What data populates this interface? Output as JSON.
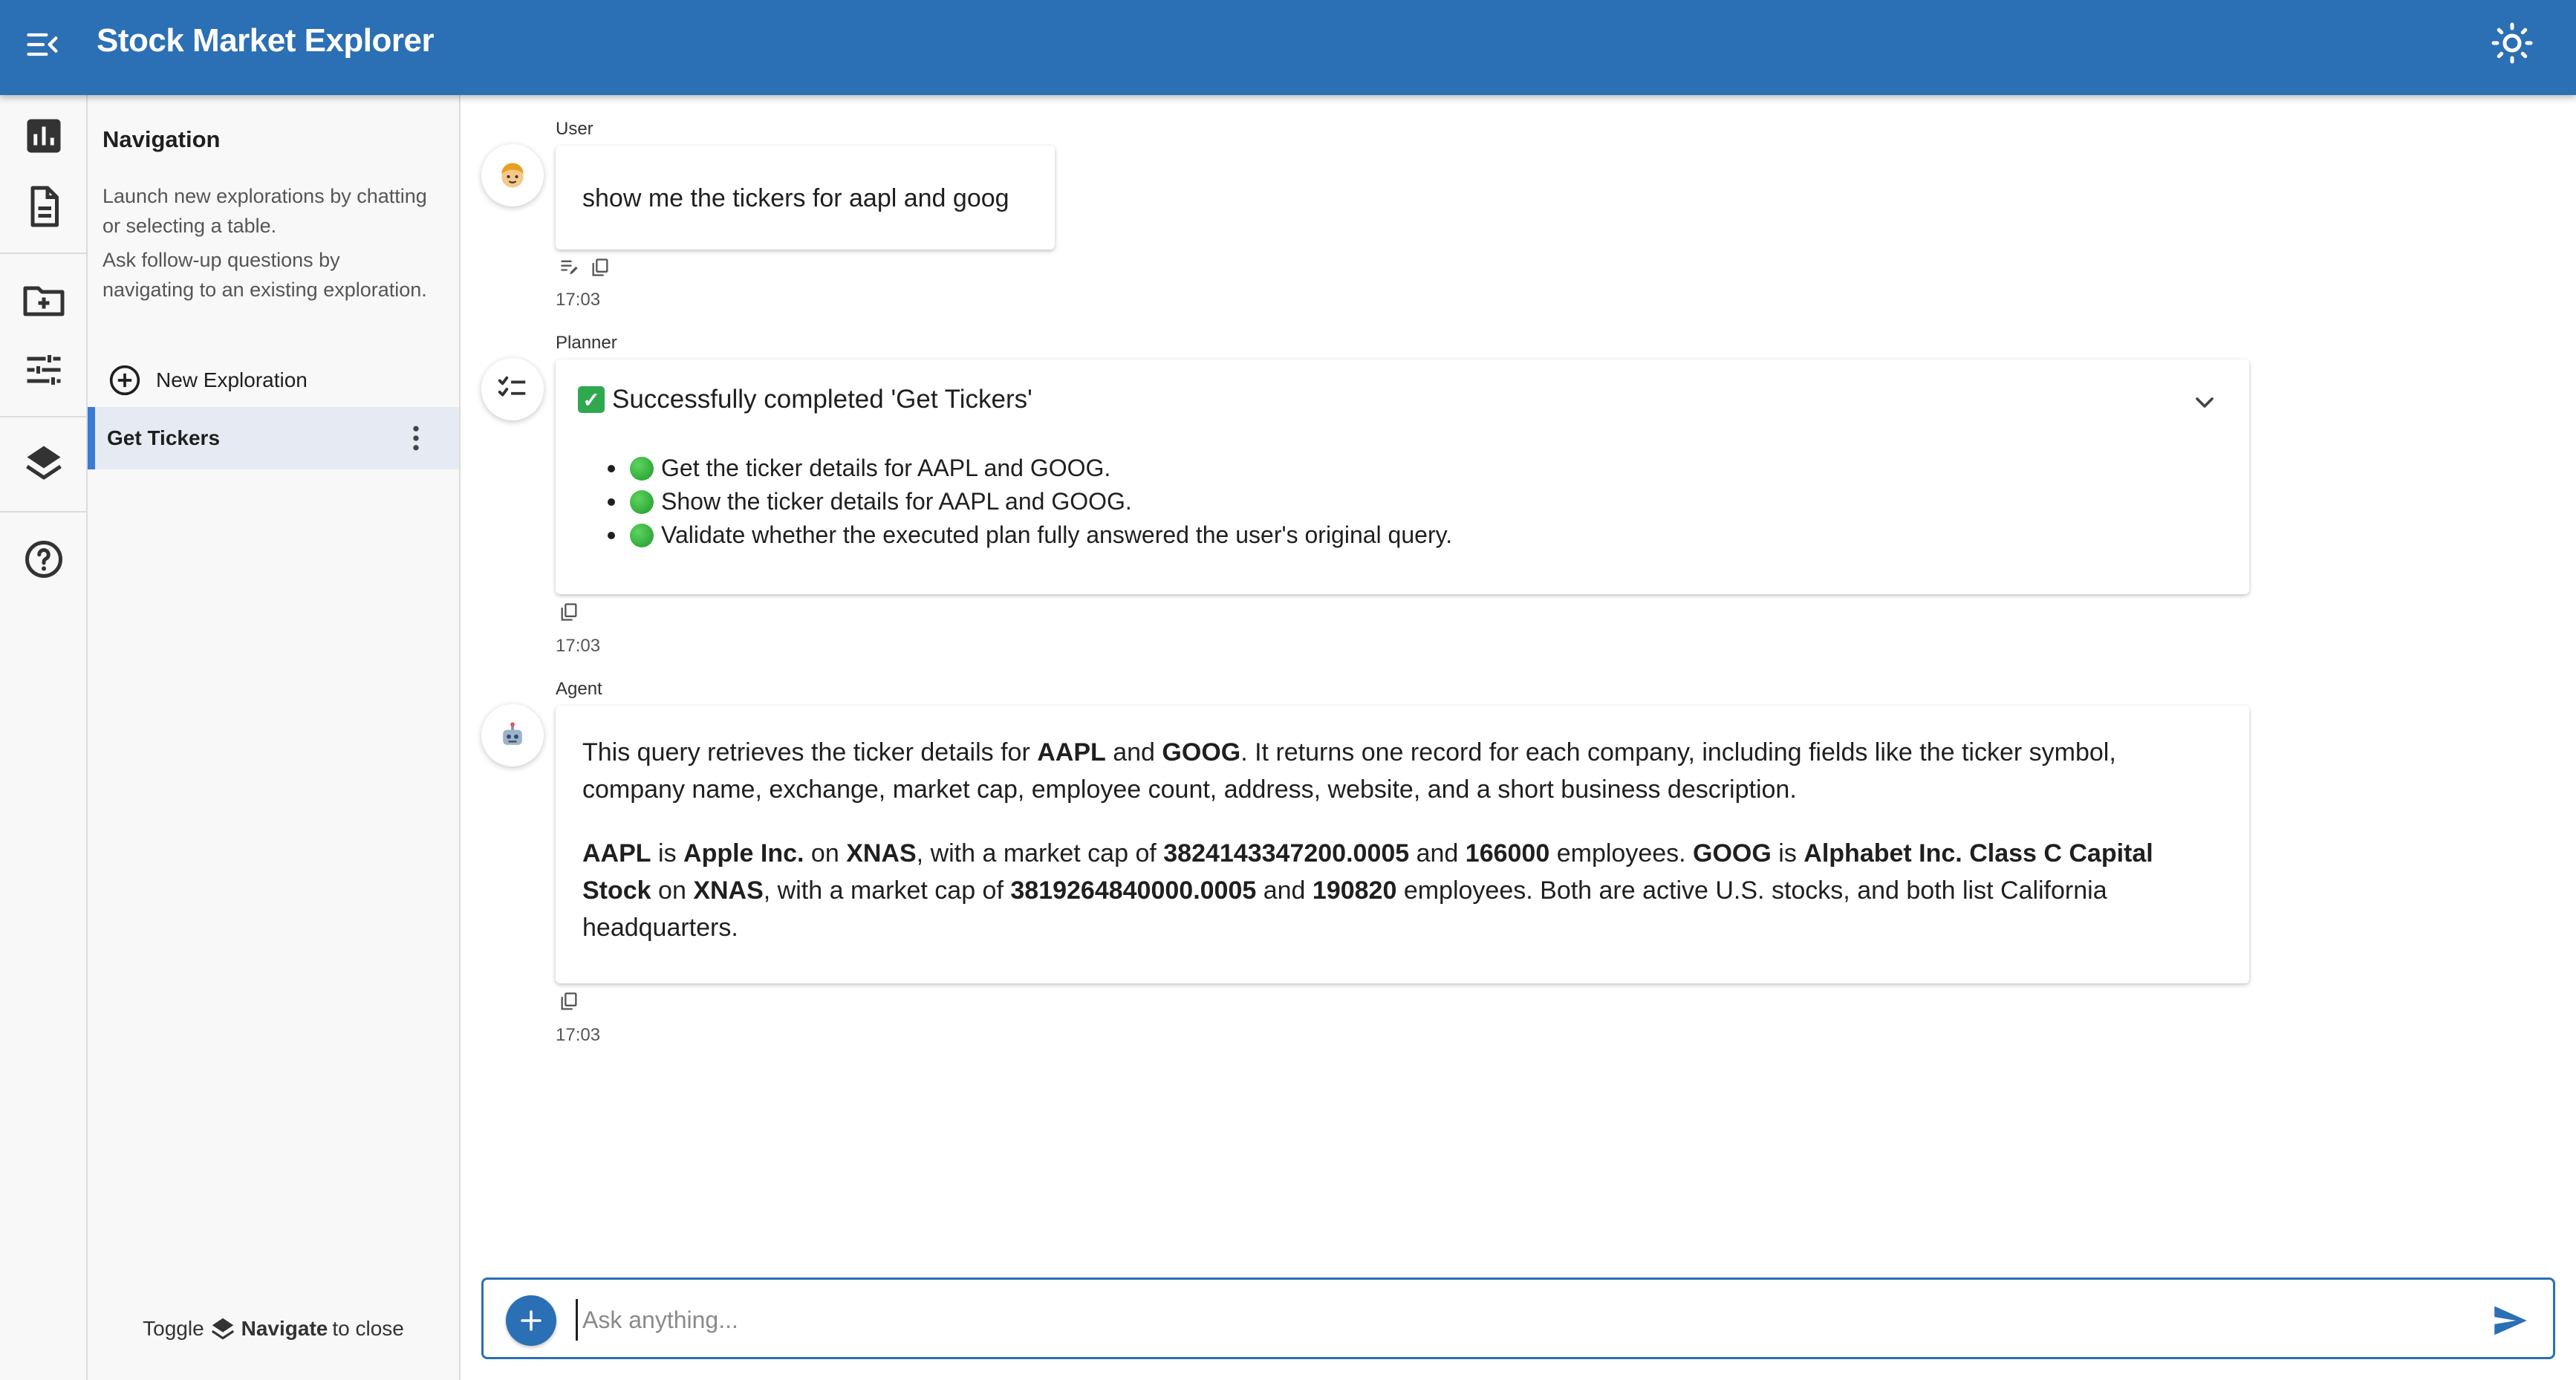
{
  "header": {
    "title": "Stock Market Explorer",
    "menu_icon": "menu-collapse-icon",
    "theme_icon": "sun-icon"
  },
  "rail": {
    "icons": [
      "bar-chart-icon",
      "document-icon",
      "folder-add-icon",
      "tune-icon",
      "layers-icon",
      "help-icon"
    ]
  },
  "nav": {
    "title": "Navigation",
    "desc_1": "Launch new explorations by chatting or selecting a table.",
    "desc_2": "Ask follow-up questions by navigating to an existing exploration.",
    "new_exploration": "New Exploration",
    "items": [
      {
        "label": "Get Tickers"
      }
    ],
    "footer": {
      "prefix": "Toggle",
      "bold": "Navigate",
      "suffix": "to close"
    }
  },
  "messages": {
    "user": {
      "role": "User",
      "text": "show me the tickers for aapl and goog",
      "time": "17:03"
    },
    "planner": {
      "role": "Planner",
      "title": "Successfully completed 'Get Tickers'",
      "steps": [
        "Get the ticker details for AAPL and GOOG.",
        "Show the ticker details for AAPL and GOOG.",
        "Validate whether the executed plan fully answered the user's original query."
      ],
      "time": "17:03"
    },
    "agent": {
      "role": "Agent",
      "p1": {
        "a": "This query retrieves the ticker details for ",
        "b": "AAPL",
        "c": " and ",
        "d": "GOOG",
        "e": ". It returns one record for each company, including fields like the ticker symbol, company name, exchange, market cap, employee count, address, website, and a short business description."
      },
      "p2": {
        "t1": "AAPL",
        "t2": " is ",
        "t3": "Apple Inc.",
        "t4": " on ",
        "t5": "XNAS",
        "t6": ", with a market cap of ",
        "t7": "3824143347200.0005",
        "t8": " and ",
        "t9": "166000",
        "t10": " employees. ",
        "t11": "GOOG",
        "t12": " is ",
        "t13": "Alphabet Inc. Class C Capital Stock",
        "t14": " on ",
        "t15": "XNAS",
        "t16": ", with a market cap of ",
        "t17": "3819264840000.0005",
        "t18": " and ",
        "t19": "190820",
        "t20": " employees. Both are active U.S. stocks, and both list California headquarters."
      },
      "time": "17:03"
    }
  },
  "composer": {
    "placeholder": "Ask anything..."
  },
  "colors": {
    "header": "#2b6fb4",
    "accent": "#3a7bd5",
    "selected_bg": "#e6ebf3"
  }
}
